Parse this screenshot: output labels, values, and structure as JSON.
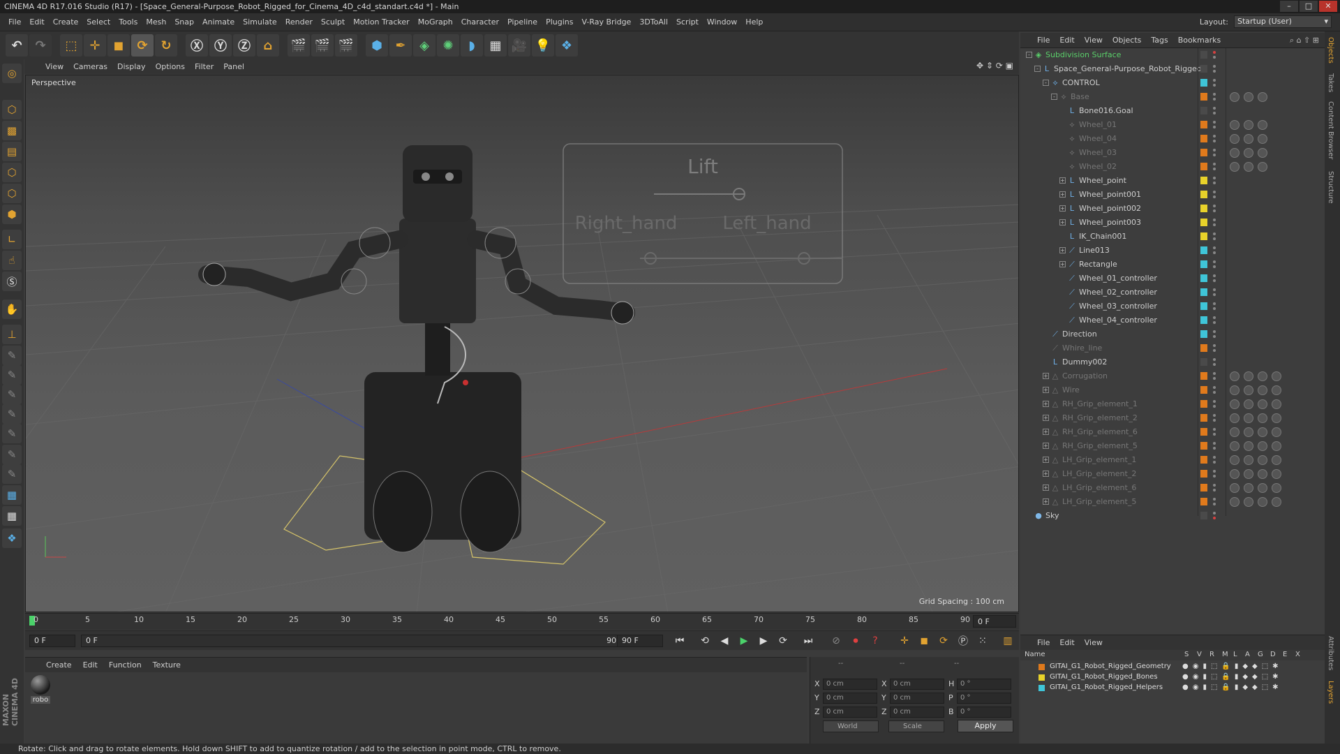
{
  "titlebar": {
    "text": "CINEMA 4D R17.016 Studio (R17) - [Space_General-Purpose_Robot_Rigged_for_Cinema_4D_c4d_standart.c4d *] - Main",
    "min": "–",
    "max": "□",
    "close": "✕"
  },
  "menubar": {
    "items": [
      "File",
      "Edit",
      "Create",
      "Select",
      "Tools",
      "Mesh",
      "Snap",
      "Animate",
      "Simulate",
      "Render",
      "Sculpt",
      "Motion Tracker",
      "MoGraph",
      "Character",
      "Pipeline",
      "Plugins",
      "V-Ray Bridge",
      "3DToAll",
      "Script",
      "Window",
      "Help"
    ],
    "layout_label": "Layout:",
    "layout_value": "Startup (User)"
  },
  "viewport_menu": {
    "items": [
      "View",
      "Cameras",
      "Display",
      "Options",
      "Filter",
      "Panel"
    ]
  },
  "viewport": {
    "label": "Perspective",
    "grid_spacing": "Grid Spacing : 100 cm",
    "hud_title": "Lift",
    "hud_right": "Right_hand",
    "hud_left": "Left_hand"
  },
  "timeline": {
    "ticks": [
      "0",
      "5",
      "10",
      "15",
      "20",
      "25",
      "30",
      "35",
      "40",
      "45",
      "50",
      "55",
      "60",
      "65",
      "70",
      "75",
      "80",
      "85",
      "90"
    ],
    "current": "0 F"
  },
  "transport": {
    "start_field": "0 F",
    "range_start": "0 F",
    "range_end": "90 F",
    "end_field": "90 F"
  },
  "material_menu": {
    "items": [
      "Create",
      "Edit",
      "Function",
      "Texture"
    ],
    "material_name": "robo"
  },
  "coords": {
    "headers": [
      "--",
      "--",
      "--"
    ],
    "rows": [
      {
        "l1": "X",
        "v1": "0 cm",
        "l2": "X",
        "v2": "0 cm",
        "l3": "H",
        "v3": "0 °"
      },
      {
        "l1": "Y",
        "v1": "0 cm",
        "l2": "Y",
        "v2": "0 cm",
        "l3": "P",
        "v3": "0 °"
      },
      {
        "l1": "Z",
        "v1": "0 cm",
        "l2": "Z",
        "v2": "0 cm",
        "l3": "B",
        "v3": "0 °"
      }
    ],
    "world": "World",
    "scale": "Scale",
    "apply": "Apply"
  },
  "statusbar": {
    "text": "Rotate: Click and drag to rotate elements. Hold down SHIFT to add to quantize rotation / add to the selection in point mode, CTRL to remove."
  },
  "object_menu": {
    "items": [
      "File",
      "Edit",
      "View",
      "Objects",
      "Tags",
      "Bookmarks"
    ]
  },
  "objects": [
    {
      "name": "Subdivision Surface",
      "depth": 0,
      "icon": "subdivision-icon",
      "color": "#5ad06a",
      "dim": false,
      "layer": "",
      "exp": "-"
    },
    {
      "name": "Space_General-Purpose_Robot_Rigged",
      "depth": 1,
      "icon": "null-icon",
      "color": "#cfcfcf",
      "dim": false,
      "layer": "",
      "exp": "-"
    },
    {
      "name": "CONTROL",
      "depth": 2,
      "icon": "joint-icon",
      "color": "#cfcfcf",
      "dim": false,
      "layer": "#3fc5d8",
      "exp": "-"
    },
    {
      "name": "Base",
      "depth": 3,
      "icon": "joint-icon",
      "color": "#777",
      "dim": true,
      "layer": "#e07a1c",
      "exp": "-"
    },
    {
      "name": "Bone016.Goal",
      "depth": 4,
      "icon": "null-icon",
      "color": "#cfcfcf",
      "dim": false,
      "layer": "",
      "exp": ""
    },
    {
      "name": "Wheel_01",
      "depth": 4,
      "icon": "joint-icon",
      "color": "#777",
      "dim": true,
      "layer": "#e07a1c",
      "exp": ""
    },
    {
      "name": "Wheel_04",
      "depth": 4,
      "icon": "joint-icon",
      "color": "#777",
      "dim": true,
      "layer": "#e07a1c",
      "exp": ""
    },
    {
      "name": "Wheel_03",
      "depth": 4,
      "icon": "joint-icon",
      "color": "#777",
      "dim": true,
      "layer": "#e07a1c",
      "exp": ""
    },
    {
      "name": "Wheel_02",
      "depth": 4,
      "icon": "joint-icon",
      "color": "#777",
      "dim": true,
      "layer": "#e07a1c",
      "exp": ""
    },
    {
      "name": "Wheel_point",
      "depth": 4,
      "icon": "null-icon",
      "color": "#cfcfcf",
      "dim": false,
      "layer": "#e8d22a",
      "exp": "+"
    },
    {
      "name": "Wheel_point001",
      "depth": 4,
      "icon": "null-icon",
      "color": "#cfcfcf",
      "dim": false,
      "layer": "#e8d22a",
      "exp": "+"
    },
    {
      "name": "Wheel_point002",
      "depth": 4,
      "icon": "null-icon",
      "color": "#cfcfcf",
      "dim": false,
      "layer": "#e8d22a",
      "exp": "+"
    },
    {
      "name": "Wheel_point003",
      "depth": 4,
      "icon": "null-icon",
      "color": "#cfcfcf",
      "dim": false,
      "layer": "#e8d22a",
      "exp": "+"
    },
    {
      "name": "IK_Chain001",
      "depth": 4,
      "icon": "null-icon",
      "color": "#cfcfcf",
      "dim": false,
      "layer": "#e8d22a",
      "exp": ""
    },
    {
      "name": "Line013",
      "depth": 4,
      "icon": "spline-icon",
      "color": "#cfcfcf",
      "dim": false,
      "layer": "#3fc5d8",
      "exp": "+"
    },
    {
      "name": "Rectangle",
      "depth": 4,
      "icon": "spline-icon",
      "color": "#cfcfcf",
      "dim": false,
      "layer": "#3fc5d8",
      "exp": "+"
    },
    {
      "name": "Wheel_01_controller",
      "depth": 4,
      "icon": "spline-icon",
      "color": "#cfcfcf",
      "dim": false,
      "layer": "#3fc5d8",
      "exp": ""
    },
    {
      "name": "Wheel_02_controller",
      "depth": 4,
      "icon": "spline-icon",
      "color": "#cfcfcf",
      "dim": false,
      "layer": "#3fc5d8",
      "exp": ""
    },
    {
      "name": "Wheel_03_controller",
      "depth": 4,
      "icon": "spline-icon",
      "color": "#cfcfcf",
      "dim": false,
      "layer": "#3fc5d8",
      "exp": ""
    },
    {
      "name": "Wheel_04_controller",
      "depth": 4,
      "icon": "spline-icon",
      "color": "#cfcfcf",
      "dim": false,
      "layer": "#3fc5d8",
      "exp": ""
    },
    {
      "name": "Direction",
      "depth": 2,
      "icon": "spline-icon",
      "color": "#cfcfcf",
      "dim": false,
      "layer": "#3fc5d8",
      "exp": ""
    },
    {
      "name": "Whire_line",
      "depth": 2,
      "icon": "spline-icon",
      "color": "#777",
      "dim": true,
      "layer": "#e07a1c",
      "exp": ""
    },
    {
      "name": "Dummy002",
      "depth": 2,
      "icon": "null-icon",
      "color": "#cfcfcf",
      "dim": false,
      "layer": "",
      "exp": ""
    },
    {
      "name": "Corrugation",
      "depth": 2,
      "icon": "mesh-icon",
      "color": "#777",
      "dim": true,
      "layer": "#e07a1c",
      "exp": "+"
    },
    {
      "name": "Wire",
      "depth": 2,
      "icon": "mesh-icon",
      "color": "#777",
      "dim": true,
      "layer": "#e07a1c",
      "exp": "+"
    },
    {
      "name": "RH_Grip_element_1",
      "depth": 2,
      "icon": "mesh-icon",
      "color": "#777",
      "dim": true,
      "layer": "#e07a1c",
      "exp": "+"
    },
    {
      "name": "RH_Grip_element_2",
      "depth": 2,
      "icon": "mesh-icon",
      "color": "#777",
      "dim": true,
      "layer": "#e07a1c",
      "exp": "+"
    },
    {
      "name": "RH_Grip_element_6",
      "depth": 2,
      "icon": "mesh-icon",
      "color": "#777",
      "dim": true,
      "layer": "#e07a1c",
      "exp": "+"
    },
    {
      "name": "RH_Grip_element_5",
      "depth": 2,
      "icon": "mesh-icon",
      "color": "#777",
      "dim": true,
      "layer": "#e07a1c",
      "exp": "+"
    },
    {
      "name": "LH_Grip_element_1",
      "depth": 2,
      "icon": "mesh-icon",
      "color": "#777",
      "dim": true,
      "layer": "#e07a1c",
      "exp": "+"
    },
    {
      "name": "LH_Grip_element_2",
      "depth": 2,
      "icon": "mesh-icon",
      "color": "#777",
      "dim": true,
      "layer": "#e07a1c",
      "exp": "+"
    },
    {
      "name": "LH_Grip_element_6",
      "depth": 2,
      "icon": "mesh-icon",
      "color": "#777",
      "dim": true,
      "layer": "#e07a1c",
      "exp": "+"
    },
    {
      "name": "LH_Grip_element_5",
      "depth": 2,
      "icon": "mesh-icon",
      "color": "#777",
      "dim": true,
      "layer": "#e07a1c",
      "exp": "+"
    },
    {
      "name": "Sky",
      "depth": 0,
      "icon": "sky-icon",
      "color": "#cfcfcf",
      "dim": false,
      "layer": "",
      "exp": ""
    }
  ],
  "right_tabs": [
    "Objects",
    "Takes",
    "Content Browser",
    "Structure",
    "Attributes",
    "Layers"
  ],
  "layer_menu": {
    "items": [
      "File",
      "Edit",
      "View"
    ]
  },
  "layer_header": {
    "name": "Name",
    "cols": [
      "S",
      "V",
      "R",
      "M",
      "L",
      "A",
      "G",
      "D",
      "E",
      "X"
    ]
  },
  "layers": [
    {
      "name": "GITAI_G1_Robot_Rigged_Geometry",
      "color": "#e07a1c"
    },
    {
      "name": "GITAI_G1_Robot_Rigged_Bones",
      "color": "#e8d22a"
    },
    {
      "name": "GITAI_G1_Robot_Rigged_Helpers",
      "color": "#3fc5d8"
    }
  ],
  "brand": "MAXON CINEMA 4D"
}
